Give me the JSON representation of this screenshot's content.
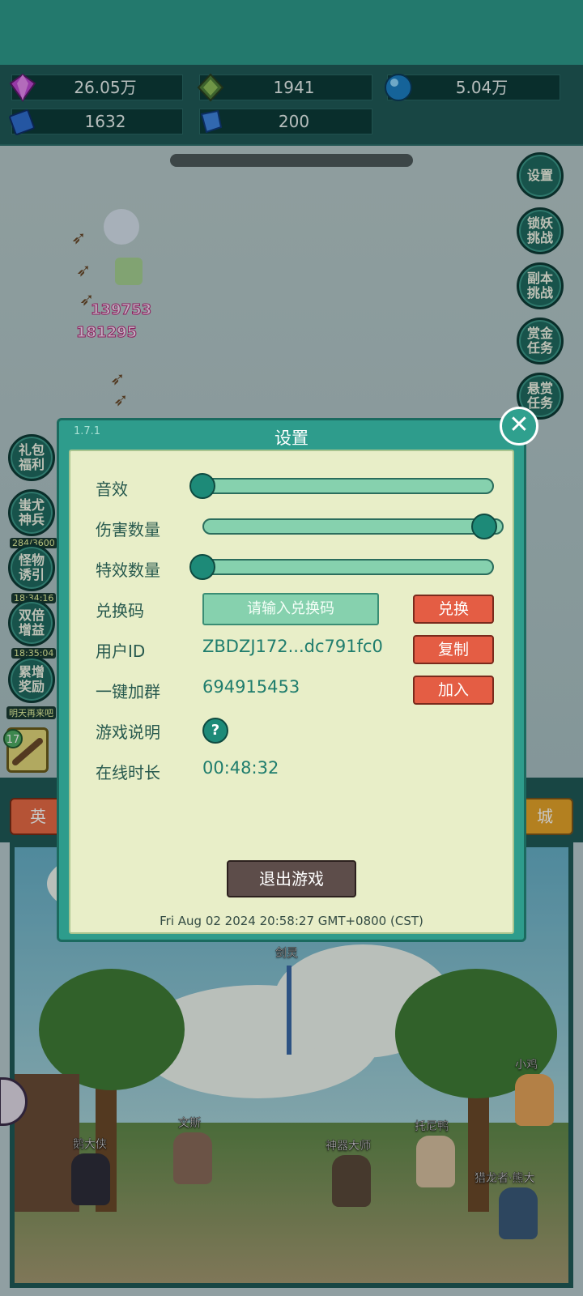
{
  "stats": {
    "gem": "26.05万",
    "jade": "1941",
    "orb": "5.04万",
    "book": "1632",
    "crystal": "200"
  },
  "side_buttons_right": [
    "设置",
    "锁妖挑战",
    "副本挑战",
    "赏金任务",
    "悬赏任务"
  ],
  "side_buttons_left": [
    {
      "label": "礼包福利",
      "tag": ""
    },
    {
      "label": "蚩尤神兵",
      "tag": "284/3600"
    },
    {
      "label": "怪物诱引",
      "tag": "18:34:16"
    },
    {
      "label": "双倍增益",
      "tag": "18:35:04"
    },
    {
      "label": "累增奖励",
      "tag": "明天再来吧"
    }
  ],
  "damage_numbers": [
    "139753",
    "181295"
  ],
  "slot_level": "17",
  "tabs": {
    "left": "英",
    "right": "城"
  },
  "dialog": {
    "version": "1.7.1",
    "title": "设置",
    "rows": {
      "sound": {
        "label": "音效",
        "value": 0.0
      },
      "damage_count": {
        "label": "伤害数量",
        "value": 1.0
      },
      "effect_count": {
        "label": "特效数量",
        "value": 0.0
      },
      "redeem": {
        "label": "兑换码",
        "placeholder": "请输入兑换码",
        "button": "兑换"
      },
      "user_id": {
        "label": "用户ID",
        "value": "ZBDZJ172...dc791fc0",
        "button": "复制"
      },
      "join_group": {
        "label": "一键加群",
        "value": "694915453",
        "button": "加入"
      },
      "instructions": {
        "label": "游戏说明",
        "icon": "?"
      },
      "online_time": {
        "label": "在线时长",
        "value": "00:48:32"
      }
    },
    "exit_button": "退出游戏",
    "timestamp": "Fri Aug 02 2024 20:58:27 GMT+0800 (CST)"
  },
  "heroes": [
    "剑灵",
    "小鸡",
    "文斯",
    "鹅大侠",
    "托尼鸭",
    "神器大师",
    "猎龙者·熊大"
  ]
}
